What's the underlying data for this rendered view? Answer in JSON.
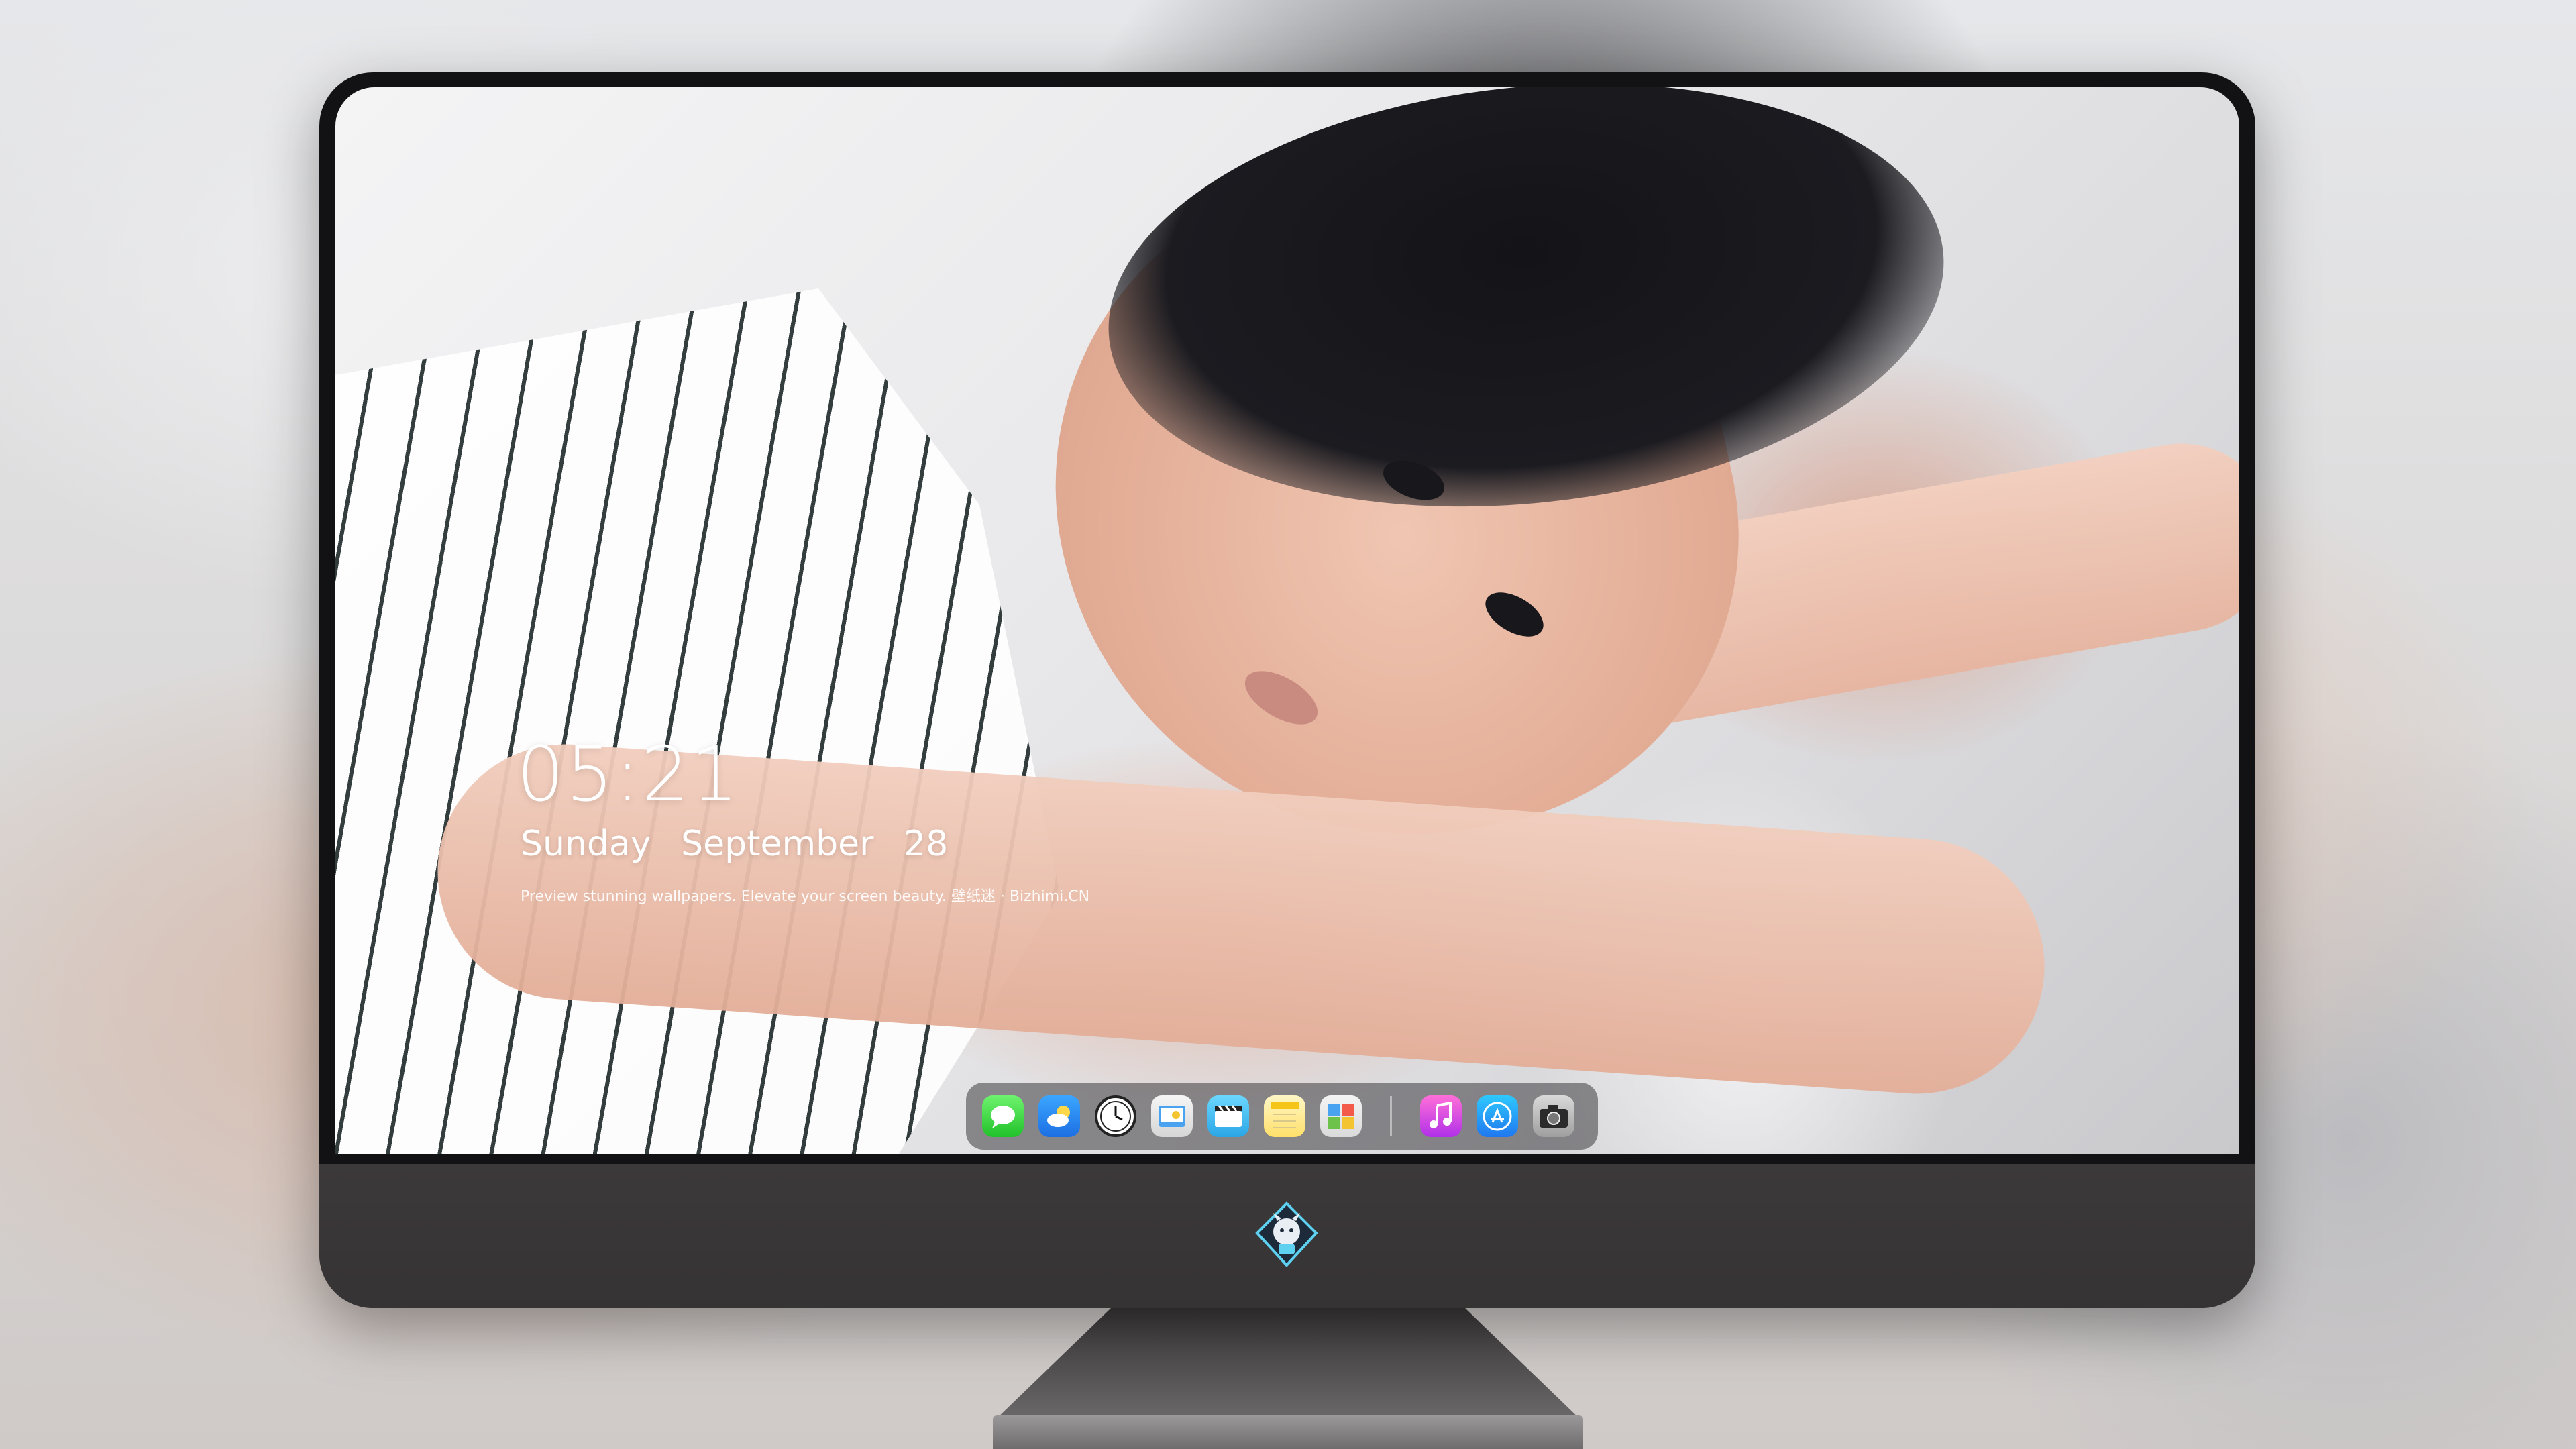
{
  "lock_screen": {
    "time": "05:21",
    "weekday": "Sunday",
    "month": "September",
    "day": "28",
    "tagline": "Preview stunning wallpapers. Elevate your screen beauty. 壁纸迷 · Bizhimi.CN"
  },
  "dock": {
    "apps": [
      {
        "name": "Messages",
        "icon": "messages-icon",
        "color": "#21c22a"
      },
      {
        "name": "Weather",
        "icon": "weather-icon",
        "color": "#1c6fe3"
      },
      {
        "name": "Clock",
        "icon": "clock-icon",
        "color": "#ffffff"
      },
      {
        "name": "Preview",
        "icon": "preview-icon",
        "color": "#d6d6d6"
      },
      {
        "name": "Clips",
        "icon": "clips-icon",
        "color": "#2aa6e6"
      },
      {
        "name": "Notes",
        "icon": "notes-icon",
        "color": "#ffe06a"
      },
      {
        "name": "Photos",
        "icon": "photos-icon",
        "color": "#dadada"
      },
      {
        "name": "Music",
        "icon": "music-icon",
        "color": "#b030e8"
      },
      {
        "name": "App Store",
        "icon": "app-store-icon",
        "color": "#1f78f0"
      },
      {
        "name": "Camera",
        "icon": "camera-icon",
        "color": "#9f9f9f"
      }
    ]
  },
  "monitor": {
    "logo_icon": "bizhimi-logo-icon"
  }
}
